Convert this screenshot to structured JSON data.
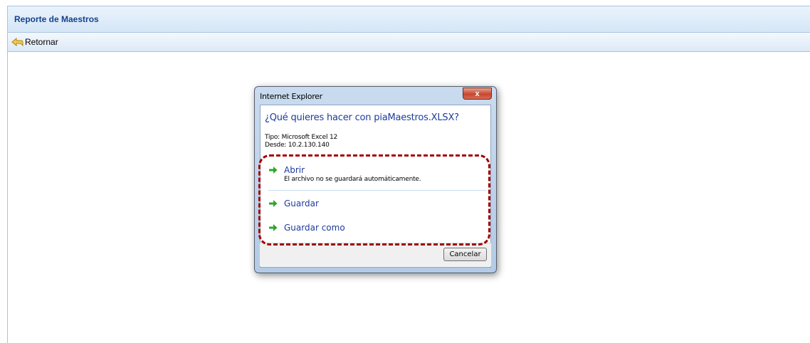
{
  "panel": {
    "title": "Reporte de Maestros"
  },
  "toolbar": {
    "return_label": "Retornar"
  },
  "dialog": {
    "title": "Internet Explorer",
    "close_symbol": "x",
    "question": "¿Qué quieres hacer con piaMaestros.XLSX?",
    "type_line": "Tipo: Microsoft Excel 12",
    "from_line": "Desde: 10.2.130.140",
    "options": [
      {
        "label": "Abrir",
        "description": "El archivo no se guardará automáticamente.",
        "icon": "green-arrow-icon"
      },
      {
        "label": "Guardar",
        "icon": "green-arrow-icon"
      },
      {
        "label": "Guardar como",
        "icon": "green-arrow-icon"
      }
    ],
    "cancel_label": "Cancelar"
  },
  "colors": {
    "header_text": "#15428b",
    "link_blue": "#1e3a9e",
    "highlight_red": "#a00000",
    "arrow_green": "#2aa82a"
  }
}
